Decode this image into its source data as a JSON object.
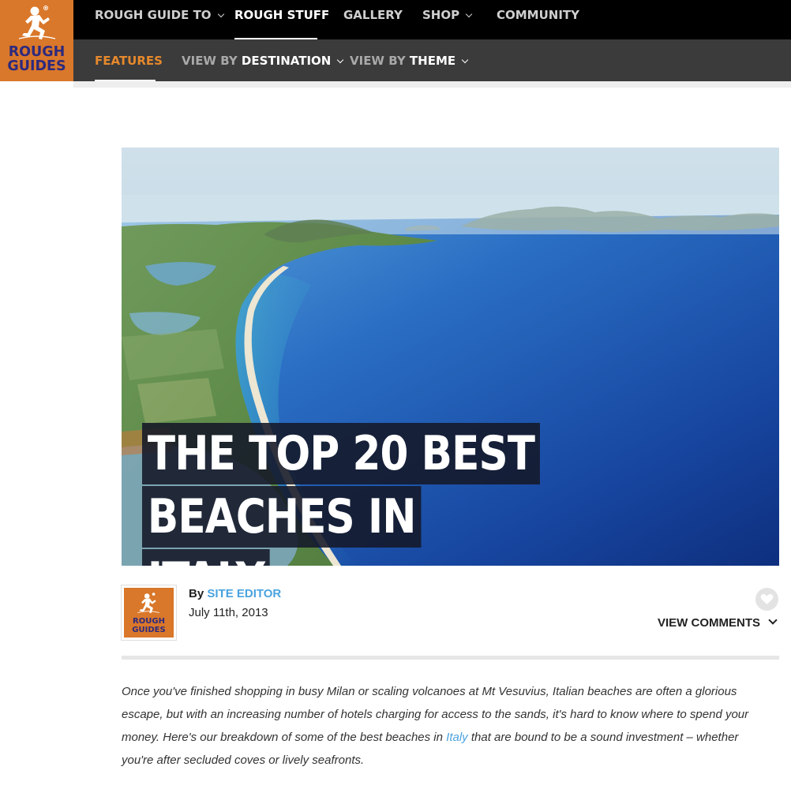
{
  "brand": {
    "line1": "ROUGH",
    "line2": "GUIDES",
    "color": "#d9772a",
    "text_color": "#2d2a7e"
  },
  "top_nav": {
    "items": [
      {
        "label": "ROUGH GUIDE TO",
        "has_dropdown": true
      },
      {
        "label": "ROUGH STUFF",
        "active": true
      },
      {
        "label": "GALLERY"
      },
      {
        "label": "SHOP",
        "has_dropdown": true
      },
      {
        "label": "COMMUNITY"
      }
    ]
  },
  "sub_nav": {
    "features": "FEATURES",
    "destination_prefix": "VIEW BY",
    "destination": "DESTINATION",
    "theme_prefix": "VIEW BY",
    "theme": "THEME",
    "accent": "#e7892c"
  },
  "hero": {
    "title_line1": "THE TOP 20 BEST BEACHES IN",
    "title_line2": "ITALY"
  },
  "author": {
    "by": "By",
    "name": "SITE EDITOR",
    "date": "July 11th, 2013",
    "avatar_line1": "ROUGH",
    "avatar_line2": "GUIDES"
  },
  "actions": {
    "view_comments": "VIEW COMMENTS",
    "like_icon": "heart-icon"
  },
  "intro": {
    "text_before": "Once you've finished shopping in busy Milan or scaling volcanoes at Mt Vesuvius, Italian beaches are often a glorious escape, but with an increasing number of hotels charging for access to the sands, it's hard to know where to spend your money. Here's our breakdown of some of the best beaches in ",
    "link": "Italy",
    "text_after": " that are bound to be a sound investment – whether you're after secluded coves or lively seafronts."
  }
}
